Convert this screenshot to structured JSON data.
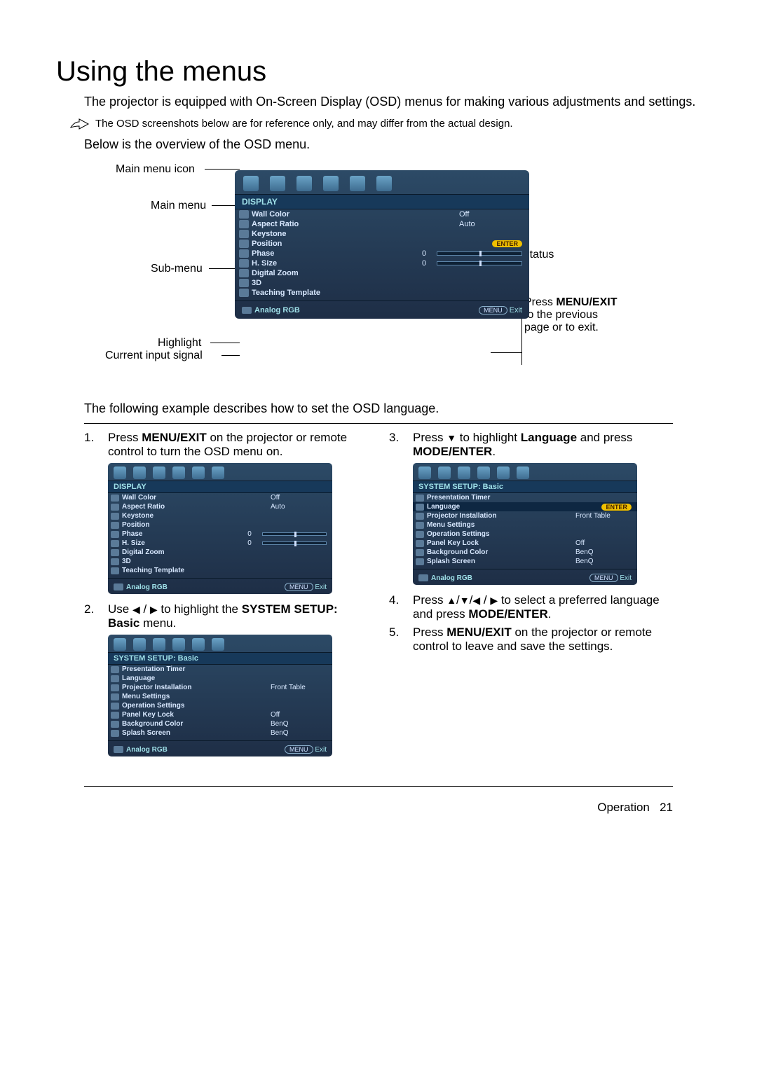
{
  "heading": "Using the menus",
  "intro": "The projector is equipped with On-Screen Display (OSD) menus for making various adjustments and settings.",
  "note": "The OSD screenshots below are for reference only, and may differ from the actual design.",
  "below_overview": "Below is the overview of the OSD menu.",
  "callouts": {
    "main_icon": "Main menu icon",
    "main_menu": "Main menu",
    "sub_menu": "Sub-menu",
    "highlight": "Highlight",
    "current_input": "Current input signal",
    "status": "Status",
    "press_menu_exit": "Press MENU/EXIT to the previous page or to exit."
  },
  "osd_main": {
    "title": "DISPLAY",
    "rows": [
      {
        "label": "Wall Color",
        "value": "Off",
        "type": "text"
      },
      {
        "label": "Aspect Ratio",
        "value": "Auto",
        "type": "text"
      },
      {
        "label": "Keystone",
        "value": "",
        "type": "none"
      },
      {
        "label": "Position",
        "value": "",
        "type": "enter"
      },
      {
        "label": "Phase",
        "value": "0",
        "type": "slider"
      },
      {
        "label": "H. Size",
        "value": "0",
        "type": "slider"
      },
      {
        "label": "Digital Zoom",
        "value": "",
        "type": "none"
      },
      {
        "label": "3D",
        "value": "",
        "type": "none"
      },
      {
        "label": "Teaching Template",
        "value": "",
        "type": "none"
      }
    ],
    "footer_left": "Analog RGB",
    "footer_menu": "MENU",
    "footer_exit": "Exit",
    "enter_label": "ENTER"
  },
  "following": "The following example describes how to set the OSD language.",
  "steps": {
    "s1_a": "Press ",
    "s1_b": "MENU/EXIT",
    "s1_c": " on the projector or remote control to turn the OSD menu on.",
    "s2_a": "Use ",
    "s2_b": " to highlight the ",
    "s2_c": "SYSTEM SETUP: Basic",
    "s2_d": " menu.",
    "s3_a": "Press ",
    "s3_b": " to highlight ",
    "s3_c": "Language",
    "s3_d": " and press ",
    "s3_e": "MODE/ENTER",
    "s4_a": "Press ",
    "s4_b": " to select a preferred language and press ",
    "s4_c": "MODE/ENTER",
    "s5_a": "Press ",
    "s5_b": "MENU/EXIT",
    "s5_c": " on the projector or remote control to leave and save the settings."
  },
  "osd_small1": {
    "title": "DISPLAY",
    "rows": [
      {
        "label": "Wall Color",
        "value": "Off",
        "type": "text"
      },
      {
        "label": "Aspect Ratio",
        "value": "Auto",
        "type": "text"
      },
      {
        "label": "Keystone",
        "value": "",
        "type": "none"
      },
      {
        "label": "Position",
        "value": "",
        "type": "none"
      },
      {
        "label": "Phase",
        "value": "0",
        "type": "slider"
      },
      {
        "label": "H. Size",
        "value": "0",
        "type": "slider"
      },
      {
        "label": "Digital Zoom",
        "value": "",
        "type": "none"
      },
      {
        "label": "3D",
        "value": "",
        "type": "none"
      },
      {
        "label": "Teaching Template",
        "value": "",
        "type": "none"
      }
    ],
    "footer_left": "Analog RGB",
    "footer_menu": "MENU",
    "footer_exit": "Exit"
  },
  "osd_small2": {
    "title": "SYSTEM SETUP: Basic",
    "rows": [
      {
        "label": "Presentation Timer",
        "value": "",
        "type": "none"
      },
      {
        "label": "Language",
        "value": "",
        "type": "none"
      },
      {
        "label": "Projector Installation",
        "value": "Front Table",
        "type": "text"
      },
      {
        "label": "Menu Settings",
        "value": "",
        "type": "none"
      },
      {
        "label": "Operation Settings",
        "value": "",
        "type": "none"
      },
      {
        "label": "Panel Key Lock",
        "value": "Off",
        "type": "text"
      },
      {
        "label": "Background Color",
        "value": "BenQ",
        "type": "text"
      },
      {
        "label": "Splash Screen",
        "value": "BenQ",
        "type": "text"
      }
    ],
    "footer_left": "Analog RGB",
    "footer_menu": "MENU",
    "footer_exit": "Exit"
  },
  "osd_small3": {
    "title": "SYSTEM SETUP: Basic",
    "highlight_row": 1,
    "rows": [
      {
        "label": "Presentation Timer",
        "value": "",
        "type": "none"
      },
      {
        "label": "Language",
        "value": "",
        "type": "enter"
      },
      {
        "label": "Projector Installation",
        "value": "Front Table",
        "type": "text"
      },
      {
        "label": "Menu Settings",
        "value": "",
        "type": "none"
      },
      {
        "label": "Operation Settings",
        "value": "",
        "type": "none"
      },
      {
        "label": "Panel Key Lock",
        "value": "Off",
        "type": "text"
      },
      {
        "label": "Background Color",
        "value": "BenQ",
        "type": "text"
      },
      {
        "label": "Splash Screen",
        "value": "BenQ",
        "type": "text"
      }
    ],
    "footer_left": "Analog RGB",
    "footer_menu": "MENU",
    "footer_exit": "Exit",
    "enter_label": "ENTER"
  },
  "footer": {
    "section": "Operation",
    "page": "21"
  }
}
